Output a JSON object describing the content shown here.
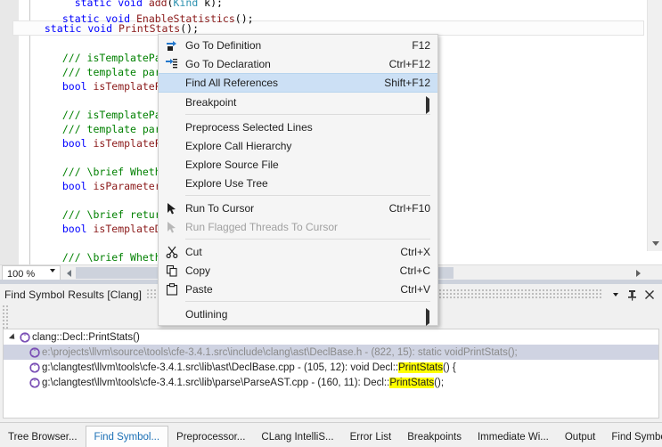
{
  "editor": {
    "code_lines": [
      [
        {
          "t": "    ",
          "c": "op"
        },
        {
          "t": "static",
          "c": "kw"
        },
        {
          "t": " ",
          "c": "op"
        },
        {
          "t": "void",
          "c": "kw"
        },
        {
          "t": " ",
          "c": "op"
        },
        {
          "t": "add",
          "c": "ident"
        },
        {
          "t": "(",
          "c": "op"
        },
        {
          "t": "Kind",
          "c": "type"
        },
        {
          "t": " k",
          "c": "op"
        },
        {
          "t": ");",
          "c": "op"
        }
      ],
      [
        {
          "t": "  ",
          "c": "op"
        },
        {
          "t": "static",
          "c": "kw"
        },
        {
          "t": " ",
          "c": "op"
        },
        {
          "t": "void",
          "c": "kw"
        },
        {
          "t": " ",
          "c": "op"
        },
        {
          "t": "EnableStatistics",
          "c": "ident"
        },
        {
          "t": "();",
          "c": "op"
        }
      ]
    ],
    "current_line": [
      {
        "t": "  ",
        "c": "op"
      },
      {
        "t": "static",
        "c": "kw"
      },
      {
        "t": " ",
        "c": "op"
      },
      {
        "t": "void",
        "c": "kw"
      },
      {
        "t": " ",
        "c": "op"
      },
      {
        "t": "PrintStats",
        "c": "ident"
      },
      {
        "t": "();",
        "c": "op"
      }
    ],
    "body_lines": [
      [],
      [
        {
          "t": "  ",
          "c": "op"
        },
        {
          "t": "/// isTemplateParameter - Determines whether this is a",
          "c": "cmt"
        }
      ],
      [
        {
          "t": "  ",
          "c": "op"
        },
        {
          "t": "/// template parameter.",
          "c": "cmt"
        }
      ],
      [
        {
          "t": "  ",
          "c": "op"
        },
        {
          "t": "bool",
          "c": "kw"
        },
        {
          "t": " ",
          "c": "op"
        },
        {
          "t": "isTemplateParameter",
          "c": "ident"
        },
        {
          "t": "() ",
          "c": "op"
        }
      ],
      [],
      [
        {
          "t": "  ",
          "c": "op"
        },
        {
          "t": "/// isTemplateParameter - Determines whether this is a",
          "c": "cmt"
        }
      ],
      [
        {
          "t": "  ",
          "c": "op"
        },
        {
          "t": "/// template parameter.",
          "c": "cmt"
        }
      ],
      [
        {
          "t": "  ",
          "c": "op"
        },
        {
          "t": "bool",
          "c": "kw"
        },
        {
          "t": " ",
          "c": "op"
        },
        {
          "t": "isTemplateParameter",
          "c": "ident"
        },
        {
          "t": "()",
          "c": "op"
        }
      ],
      [],
      [
        {
          "t": "  ",
          "c": "op"
        },
        {
          "t": "/// \\brief Whether this",
          "c": "cmt"
        }
      ],
      [
        {
          "t": "  ",
          "c": "op"
        },
        {
          "t": "bool",
          "c": "kw"
        },
        {
          "t": " ",
          "c": "op"
        },
        {
          "t": "isParameterPack",
          "c": "ident"
        },
        {
          "t": "()",
          "c": "op"
        }
      ],
      [],
      [
        {
          "t": "  ",
          "c": "op"
        },
        {
          "t": "/// \\brief returns",
          "c": "cmt"
        }
      ],
      [
        {
          "t": "  ",
          "c": "op"
        },
        {
          "t": "bool",
          "c": "kw"
        },
        {
          "t": " ",
          "c": "op"
        },
        {
          "t": "isTemplateDecl",
          "c": "ident"
        },
        {
          "t": "()",
          "c": "op"
        }
      ],
      [],
      [
        {
          "t": "  ",
          "c": "op"
        },
        {
          "t": "/// \\brief Whether this is a template.",
          "c": "cmt"
        }
      ]
    ]
  },
  "status_bar": {
    "zoom_value": "100 %",
    "zoom_caret_icon": "chevron-down-icon",
    "scroll_left_icon": "triangle-left-icon",
    "scroll_right_icon": "triangle-right-icon"
  },
  "context_menu": {
    "items": [
      {
        "label": "Go To Definition",
        "shortcut": "F12",
        "icon": "go-to-definition-icon",
        "selected": false,
        "disabled": false,
        "submenu": false,
        "separator_after": false
      },
      {
        "label": "Go To Declaration",
        "shortcut": "Ctrl+F12",
        "icon": "go-to-declaration-icon",
        "selected": false,
        "disabled": false,
        "submenu": false,
        "separator_after": false
      },
      {
        "label": "Find All References",
        "shortcut": "Shift+F12",
        "icon": "",
        "selected": true,
        "disabled": false,
        "submenu": false,
        "separator_after": false
      },
      {
        "label": "Breakpoint",
        "shortcut": "",
        "icon": "",
        "selected": false,
        "disabled": false,
        "submenu": true,
        "separator_after": true
      },
      {
        "label": "Preprocess Selected Lines",
        "shortcut": "",
        "icon": "",
        "selected": false,
        "disabled": false,
        "submenu": false,
        "separator_after": false
      },
      {
        "label": "Explore Call Hierarchy",
        "shortcut": "",
        "icon": "",
        "selected": false,
        "disabled": false,
        "submenu": false,
        "separator_after": false
      },
      {
        "label": "Explore Source File",
        "shortcut": "",
        "icon": "",
        "selected": false,
        "disabled": false,
        "submenu": false,
        "separator_after": false
      },
      {
        "label": "Explore Use Tree",
        "shortcut": "",
        "icon": "",
        "selected": false,
        "disabled": false,
        "submenu": false,
        "separator_after": true
      },
      {
        "label": "Run To Cursor",
        "shortcut": "Ctrl+F10",
        "icon": "cursor-arrow-icon",
        "selected": false,
        "disabled": false,
        "submenu": false,
        "separator_after": false
      },
      {
        "label": "Run Flagged Threads To Cursor",
        "shortcut": "",
        "icon": "cursor-arrow-dim-icon",
        "selected": false,
        "disabled": true,
        "submenu": false,
        "separator_after": true
      },
      {
        "label": "Cut",
        "shortcut": "Ctrl+X",
        "icon": "scissors-icon",
        "selected": false,
        "disabled": false,
        "submenu": false,
        "separator_after": false
      },
      {
        "label": "Copy",
        "shortcut": "Ctrl+C",
        "icon": "copy-icon",
        "selected": false,
        "disabled": false,
        "submenu": false,
        "separator_after": false
      },
      {
        "label": "Paste",
        "shortcut": "Ctrl+V",
        "icon": "paste-icon",
        "selected": false,
        "disabled": false,
        "submenu": false,
        "separator_after": true
      },
      {
        "label": "Outlining",
        "shortcut": "",
        "icon": "",
        "selected": false,
        "disabled": false,
        "submenu": true,
        "separator_after": false
      }
    ]
  },
  "find_symbol_results": {
    "title": "Find Symbol Results [Clang]",
    "header_buttons": [
      {
        "name": "dropdown-icon",
        "glyph": "▾"
      },
      {
        "name": "pin-icon",
        "glyph": "⊥"
      },
      {
        "name": "close-icon",
        "glyph": "✕"
      }
    ],
    "root": {
      "label": "clang::Decl::PrintStats()",
      "expanded": true
    },
    "rows": [
      {
        "selected": true,
        "prefix": "e:\\projects\\llvm\\source\\tools\\cfe-3.4.1.src\\include\\clang\\ast\\DeclBase.h - (822, 15): static void ",
        "highlight": "PrintStats",
        "suffix": "();"
      },
      {
        "selected": false,
        "prefix": "g:\\clangtest\\llvm\\tools\\cfe-3.4.1.src\\lib\\ast\\DeclBase.cpp - (105, 12): void Decl::",
        "highlight": "PrintStats",
        "suffix": "() {"
      },
      {
        "selected": false,
        "prefix": "g:\\clangtest\\llvm\\tools\\cfe-3.4.1.src\\lib\\parse\\ParseAST.cpp - (160, 11): Decl::",
        "highlight": "PrintStats",
        "suffix": "();"
      }
    ]
  },
  "tabs": [
    {
      "label": "Tree Browser...",
      "active": false
    },
    {
      "label": "Find Symbol...",
      "active": true
    },
    {
      "label": "Preprocessor...",
      "active": false
    },
    {
      "label": "CLang IntelliS...",
      "active": false
    },
    {
      "label": "Error List",
      "active": false
    },
    {
      "label": "Breakpoints",
      "active": false
    },
    {
      "label": "Immediate Wi...",
      "active": false
    },
    {
      "label": "Output",
      "active": false
    },
    {
      "label": "Find Symbol...",
      "active": false
    }
  ],
  "colors": {
    "selection_blue": "#cce0f5",
    "highlight_yellow": "#ffff00",
    "row_selected": "#cfd3e2",
    "accent_link": "#1a6fb5"
  }
}
